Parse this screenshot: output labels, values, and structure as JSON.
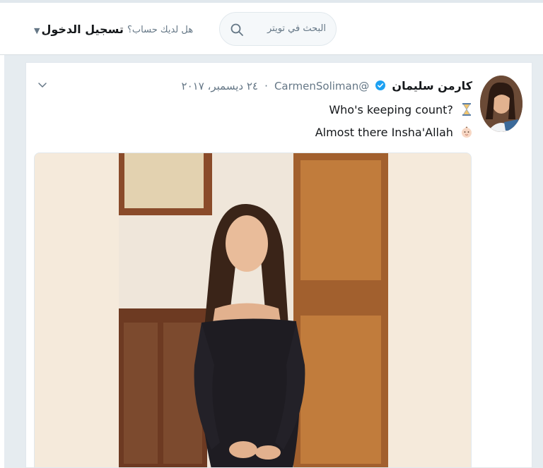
{
  "header": {
    "login_label": "تسجيل الدخول",
    "have_account_text": "هل لديك حساب؟",
    "search": {
      "placeholder": "البحث في تويتر"
    }
  },
  "tweet": {
    "display_name": "كارمن سليمان",
    "verified": true,
    "handle": "@CarmenSoliman",
    "date": "٢٤ ديسمبر، ٢٠١٧",
    "lines": [
      {
        "text": "Who's keeping count?",
        "emoji": "hourglass"
      },
      {
        "text": "Almost there Insha'Allah",
        "emoji": "baby-face"
      }
    ]
  },
  "colors": {
    "background": "#e6ecf0",
    "verified_blue": "#1da1f2",
    "text_primary": "#14171a",
    "text_secondary": "#657786"
  }
}
